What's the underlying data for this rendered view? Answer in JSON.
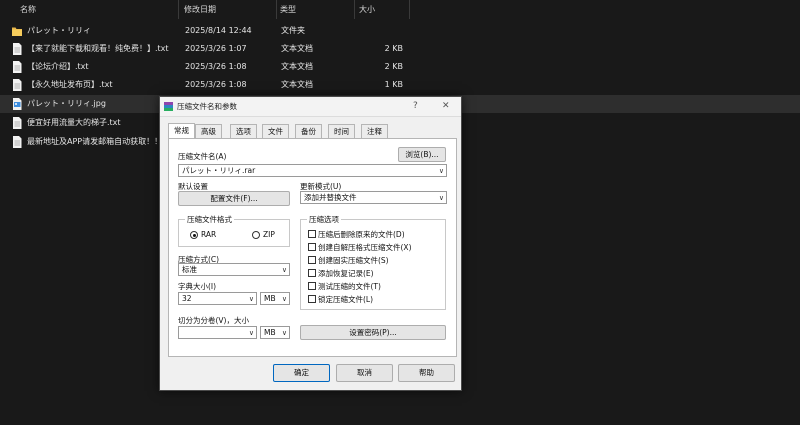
{
  "explorer": {
    "columns": {
      "name": "名称",
      "date": "修改日期",
      "type": "类型",
      "size": "大小"
    },
    "rows": [
      {
        "icon": "folder-icon",
        "name": "パレット・リリィ",
        "date": "2025/8/14 12:44",
        "type": "文件夹",
        "size": ""
      },
      {
        "icon": "text-file-icon",
        "name": "【来了就能下载和观看！纯免费！】.txt",
        "date": "2025/3/26 1:07",
        "type": "文本文档",
        "size": "2 KB"
      },
      {
        "icon": "text-file-icon",
        "name": "【论坛介绍】.txt",
        "date": "2025/3/26 1:08",
        "type": "文本文档",
        "size": "2 KB"
      },
      {
        "icon": "text-file-icon",
        "name": "【永久地址发布页】.txt",
        "date": "2025/3/26 1:08",
        "type": "文本文档",
        "size": "1 KB"
      },
      {
        "icon": "image-file-icon",
        "name": "パレット・リリィ.jpg",
        "date": "",
        "type": "",
        "size": ""
      },
      {
        "icon": "text-file-icon",
        "name": "便宜好用流量大的梯子.txt",
        "date": "",
        "type": "",
        "size": ""
      },
      {
        "icon": "text-file-icon",
        "name": "最新地址及APP请发邮箱自动获取！！",
        "date": "",
        "type": "",
        "size": ""
      }
    ]
  },
  "dialog": {
    "title": "压缩文件名和参数",
    "help_glyph": "?",
    "close_glyph": "✕",
    "tabs": [
      "常规",
      "高级",
      "选项",
      "文件",
      "备份",
      "时间",
      "注释"
    ],
    "active_tab": "常规",
    "archive_name_label": "压缩文件名(A)",
    "browse_button": "浏览(B)...",
    "archive_name_value": "パレット・リリィ.rar",
    "default_settings_label": "默认设置",
    "profiles_button": "配置文件(F)...",
    "update_mode_label": "更新模式(U)",
    "update_mode_value": "添加并替换文件",
    "format_group": "压缩文件格式",
    "format_rar": "RAR",
    "format_zip": "ZIP",
    "format_selected": "RAR",
    "options_group": "压缩选项",
    "options": [
      {
        "label": "压缩后删除原来的文件(D)",
        "checked": false
      },
      {
        "label": "创建自解压格式压缩文件(X)",
        "checked": false
      },
      {
        "label": "创建固实压缩文件(S)",
        "checked": false
      },
      {
        "label": "添加恢复记录(E)",
        "checked": false
      },
      {
        "label": "测试压缩的文件(T)",
        "checked": false
      },
      {
        "label": "锁定压缩文件(L)",
        "checked": false
      }
    ],
    "method_label": "压缩方式(C)",
    "method_value": "标准",
    "dict_label": "字典大小(I)",
    "dict_value": "32",
    "dict_unit": "MB",
    "split_label": "切分为分卷(V)，大小",
    "split_value": "",
    "split_unit": "MB",
    "password_button": "设置密码(P)...",
    "ok_button": "确定",
    "cancel_button": "取消",
    "help_button": "帮助",
    "chevron_glyph": "∨",
    "arrow_glyph": "⌄"
  }
}
